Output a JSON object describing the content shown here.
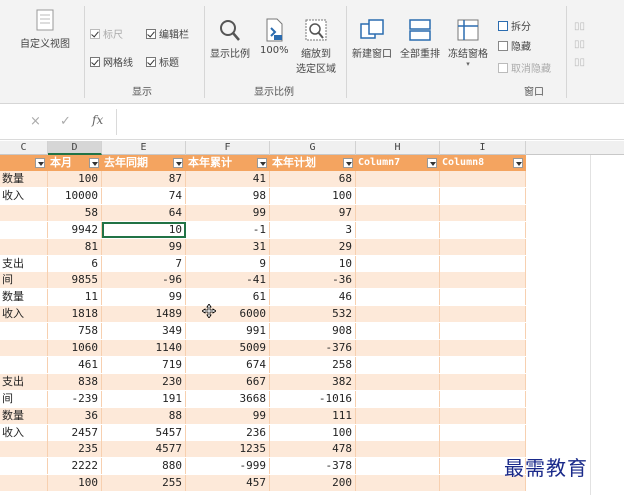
{
  "ribbon": {
    "custom_view": "自定义视图",
    "show_group": {
      "label": "显示",
      "ruler": "标尺",
      "formula_bar": "编辑栏",
      "gridlines": "网格线",
      "headings": "标题"
    },
    "zoom_group": {
      "label": "显示比例",
      "zoom": "显示比例",
      "zoom_100": "100%",
      "zoom_selection_1": "缩放到",
      "zoom_selection_2": "选定区域"
    },
    "window_group": {
      "label": "窗口",
      "new_window": "新建窗口",
      "arrange_all": "全部重排",
      "freeze_panes": "冻结窗格",
      "split": "拆分",
      "hide": "隐藏",
      "unhide": "取消隐藏"
    }
  },
  "formula_bar": {
    "fx": "fx",
    "cancel": "×",
    "enter": "✓"
  },
  "columns": [
    "C",
    "D",
    "E",
    "F",
    "G",
    "H",
    "I"
  ],
  "table_headers": [
    "本月",
    "去年同期",
    "本年累计",
    "本年计划",
    "Column7",
    "Column8"
  ],
  "rows": [
    {
      "label": "数量",
      "c": "100",
      "d": "87",
      "e": "41",
      "f": "68"
    },
    {
      "label": "收入",
      "c": "10000",
      "d": "74",
      "e": "98",
      "f": "100"
    },
    {
      "label": "",
      "c": "58",
      "d": "64",
      "e": "99",
      "f": "97"
    },
    {
      "label": "",
      "c": "9942",
      "d": "10",
      "e": "-1",
      "f": "3"
    },
    {
      "label": "",
      "c": "81",
      "d": "99",
      "e": "31",
      "f": "29"
    },
    {
      "label": "支出",
      "c": "6",
      "d": "7",
      "e": "9",
      "f": "10"
    },
    {
      "label": "间",
      "c": "9855",
      "d": "-96",
      "e": "-41",
      "f": "-36"
    },
    {
      "label": "数量",
      "c": "11",
      "d": "99",
      "e": "61",
      "f": "46"
    },
    {
      "label": "收入",
      "c": "1818",
      "d": "1489",
      "e": "6000",
      "f": "532"
    },
    {
      "label": "",
      "c": "758",
      "d": "349",
      "e": "991",
      "f": "908"
    },
    {
      "label": "",
      "c": "1060",
      "d": "1140",
      "e": "5009",
      "f": "-376"
    },
    {
      "label": "",
      "c": "461",
      "d": "719",
      "e": "674",
      "f": "258"
    },
    {
      "label": "支出",
      "c": "838",
      "d": "230",
      "e": "667",
      "f": "382"
    },
    {
      "label": "间",
      "c": "-239",
      "d": "191",
      "e": "3668",
      "f": "-1016"
    },
    {
      "label": "数量",
      "c": "36",
      "d": "88",
      "e": "99",
      "f": "111"
    },
    {
      "label": "收入",
      "c": "2457",
      "d": "5457",
      "e": "236",
      "f": "100"
    },
    {
      "label": "",
      "c": "235",
      "d": "4577",
      "e": "1235",
      "f": "478"
    },
    {
      "label": "",
      "c": "2222",
      "d": "880",
      "e": "-999",
      "f": "-378"
    },
    {
      "label": "",
      "c": "100",
      "d": "255",
      "e": "457",
      "f": "200"
    }
  ],
  "selected_row": 3,
  "watermark": "最需教育",
  "colors": {
    "header_orange": "#f4a460",
    "band_light": "#fde9d9",
    "selection_green": "#217346"
  }
}
